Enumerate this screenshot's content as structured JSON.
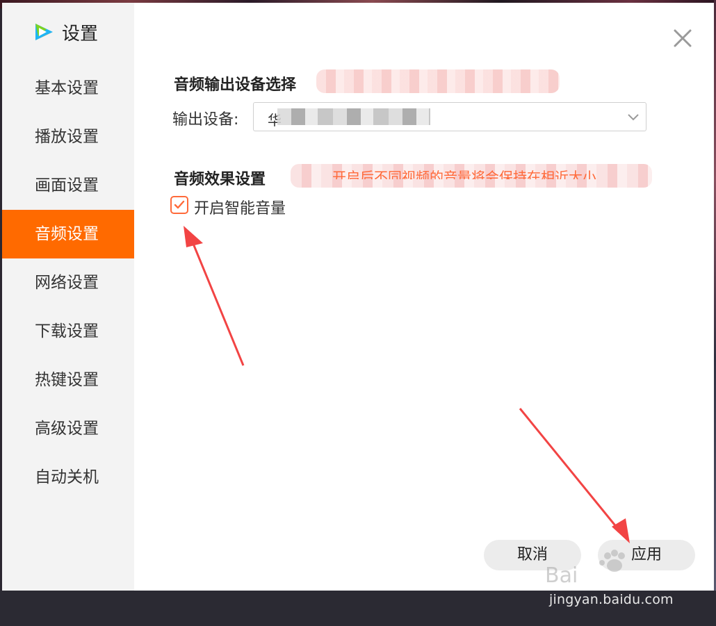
{
  "window": {
    "title": "设置"
  },
  "sidebar": {
    "items": [
      {
        "label": "基本设置",
        "active": false
      },
      {
        "label": "播放设置",
        "active": false
      },
      {
        "label": "画面设置",
        "active": false
      },
      {
        "label": "音频设置",
        "active": true
      },
      {
        "label": "网络设置",
        "active": false
      },
      {
        "label": "下载设置",
        "active": false
      },
      {
        "label": "热键设置",
        "active": false
      },
      {
        "label": "高级设置",
        "active": false
      },
      {
        "label": "自动关机",
        "active": false
      }
    ]
  },
  "audio_output": {
    "title": "音频输出设备选择",
    "device_label": "输出设备:",
    "device_value_visible": "华"
  },
  "audio_effect": {
    "title": "音频效果设置",
    "hint_partial": "开启后不同视频的音量将会保持在相近大小",
    "smart_volume_label": "开启智能音量",
    "smart_volume_checked": true
  },
  "buttons": {
    "cancel": "取消",
    "apply": "应用"
  },
  "watermark": {
    "url": "jingyan.baidu.com",
    "brand": "Baidu经验"
  },
  "colors": {
    "accent": "#ff6a00",
    "annotation_arrow": "#f24444"
  },
  "icons": [
    "app-logo-icon",
    "close-icon",
    "chevron-down-icon",
    "checkmark-icon",
    "annotation-arrow-icon"
  ]
}
